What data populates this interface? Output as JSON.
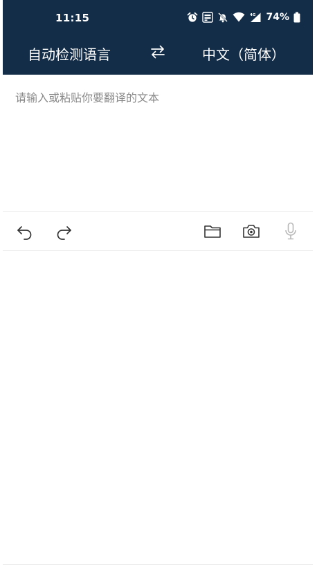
{
  "status_bar": {
    "time": "11:15",
    "battery": "74%",
    "icons": [
      "alarm-icon",
      "volte-icon",
      "mute-icon",
      "wifi-icon",
      "cellular-4g-icon",
      "battery-icon"
    ]
  },
  "language_bar": {
    "source": "自动检测语言",
    "swap_icon": "swap-arrows-icon",
    "target": "中文（简体）"
  },
  "input": {
    "placeholder": "请输入或粘贴你要翻译的文本",
    "value": ""
  },
  "toolbar": {
    "icons": [
      "undo-icon",
      "redo-icon",
      "folder-icon",
      "camera-icon",
      "microphone-icon"
    ]
  },
  "colors": {
    "header_bg": "#132c48",
    "header_text": "#ffffff",
    "placeholder": "#8a8a8a",
    "icon": "#333333",
    "icon_disabled": "#b8b8b8"
  }
}
